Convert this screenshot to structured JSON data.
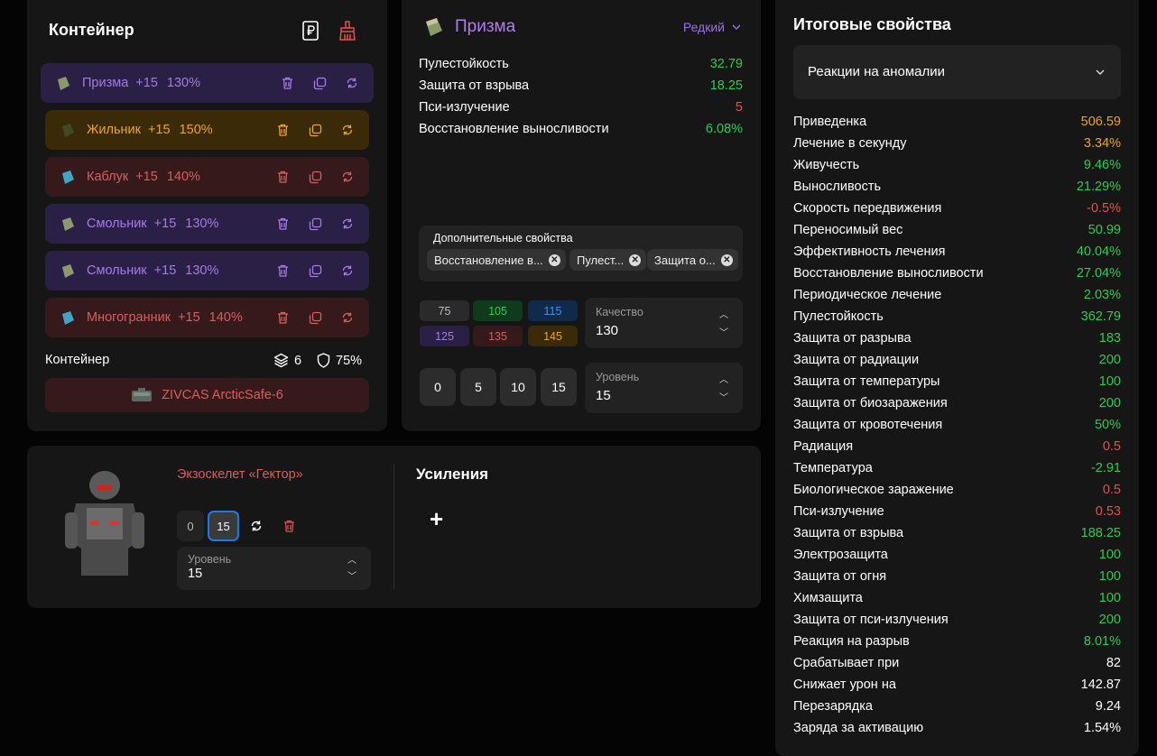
{
  "container": {
    "title": "Контейнер",
    "artifacts": [
      {
        "name": "Призма",
        "level": "+15",
        "quality": "130%",
        "color": "purple"
      },
      {
        "name": "Жильник",
        "level": "+15",
        "quality": "150%",
        "color": "orange"
      },
      {
        "name": "Каблук",
        "level": "+15",
        "quality": "140%",
        "color": "red"
      },
      {
        "name": "Смольник",
        "level": "+15",
        "quality": "130%",
        "color": "purple"
      },
      {
        "name": "Смольник",
        "level": "+15",
        "quality": "130%",
        "color": "purple"
      },
      {
        "name": "Многогранник",
        "level": "+15",
        "quality": "140%",
        "color": "red"
      }
    ],
    "footer_label": "Контейнер",
    "slots": "6",
    "protection": "75%",
    "case_name": "ZIVCAS ArcticSafe-6"
  },
  "detail": {
    "name": "Призма",
    "rarity": "Редкий",
    "stats": [
      {
        "name": "Пулестойкость",
        "value": "32.79",
        "color": "#2ecc55"
      },
      {
        "name": "Защита от взрыва",
        "value": "18.25",
        "color": "#2ecc55"
      },
      {
        "name": "Пси-излучение",
        "value": "5",
        "color": "#e0524e"
      },
      {
        "name": "Восстановление выносливости",
        "value": "6.08%",
        "color": "#2ecc55"
      }
    ],
    "additional_label": "Дополнительные свойства",
    "chips": [
      "Восстановление в...",
      "Пулест...",
      "Защита о..."
    ],
    "quality_buttons": [
      {
        "label": "75",
        "bg": "#2a2a2a",
        "fg": "#bbbbbb"
      },
      {
        "label": "105",
        "bg": "#103a1c",
        "fg": "#2ecc55"
      },
      {
        "label": "115",
        "bg": "#0f2a4a",
        "fg": "#4a90e0"
      },
      {
        "label": "125",
        "bg": "#2a1f45",
        "fg": "#a87ae8"
      },
      {
        "label": "135",
        "bg": "#36191b",
        "fg": "#d4605e"
      },
      {
        "label": "145",
        "bg": "#3a2a08",
        "fg": "#f0a32a"
      }
    ],
    "quality_label": "Качество",
    "quality_value": "130",
    "level_buttons": [
      "0",
      "5",
      "10",
      "15"
    ],
    "level_label": "Уровень",
    "level_value": "15"
  },
  "exo": {
    "name": "Экзоскелет «Гектор»",
    "btn_0": "0",
    "btn_15": "15",
    "level_label": "Уровень",
    "level_value": "15",
    "boost_title": "Усиления",
    "plus": "+"
  },
  "total": {
    "title": "Итоговые свойства",
    "dropdown": "Реакции на аномалии",
    "rows": [
      {
        "name": "Приведенка",
        "value": "506.59",
        "color": "#f0a32a"
      },
      {
        "name": "Лечение в секунду",
        "value": "3.34%",
        "color": "#f0a32a"
      },
      {
        "name": "Живучесть",
        "value": "9.46%",
        "color": "#2ecc55"
      },
      {
        "name": "Выносливость",
        "value": "21.29%",
        "color": "#2ecc55"
      },
      {
        "name": "Скорость передвижения",
        "value": "-0.5%",
        "color": "#e0524e"
      },
      {
        "name": "Переносимый вес",
        "value": "50.99",
        "color": "#2ecc55"
      },
      {
        "name": "Эффективность лечения",
        "value": "40.04%",
        "color": "#2ecc55"
      },
      {
        "name": "Восстановление выносливости",
        "value": "27.04%",
        "color": "#2ecc55"
      },
      {
        "name": "Периодическое лечение",
        "value": "2.03%",
        "color": "#2ecc55"
      },
      {
        "name": "Пулестойкость",
        "value": "362.79",
        "color": "#2ecc55"
      },
      {
        "name": "Защита от разрыва",
        "value": "183",
        "color": "#2ecc55"
      },
      {
        "name": "Защита от радиации",
        "value": "200",
        "color": "#2ecc55"
      },
      {
        "name": "Защита от температуры",
        "value": "100",
        "color": "#2ecc55"
      },
      {
        "name": "Защита от биозаражения",
        "value": "200",
        "color": "#2ecc55"
      },
      {
        "name": "Защита от кровотечения",
        "value": "50%",
        "color": "#2ecc55"
      },
      {
        "name": "Радиация",
        "value": "0.5",
        "color": "#e0524e"
      },
      {
        "name": "Температура",
        "value": "-2.91",
        "color": "#2ecc55"
      },
      {
        "name": "Биологическое заражение",
        "value": "0.5",
        "color": "#e0524e"
      },
      {
        "name": "Пси-излучение",
        "value": "0.53",
        "color": "#e0524e"
      },
      {
        "name": "Защита от взрыва",
        "value": "188.25",
        "color": "#2ecc55"
      },
      {
        "name": "Электрозащита",
        "value": "100",
        "color": "#2ecc55"
      },
      {
        "name": "Защита от огня",
        "value": "100",
        "color": "#2ecc55"
      },
      {
        "name": "Химзащита",
        "value": "100",
        "color": "#2ecc55"
      },
      {
        "name": "Защита от пси-излучения",
        "value": "200",
        "color": "#2ecc55"
      },
      {
        "name": "Реакция на разрыв",
        "value": "8.01%",
        "color": "#2ecc55"
      },
      {
        "name": "Срабатывает при",
        "value": "82",
        "color": "#ffffff"
      },
      {
        "name": "Снижает урон на",
        "value": "142.87",
        "color": "#ffffff"
      },
      {
        "name": "Перезарядка",
        "value": "9.24",
        "color": "#ffffff"
      },
      {
        "name": "Заряда за активацию",
        "value": "1.54%",
        "color": "#ffffff"
      }
    ]
  }
}
